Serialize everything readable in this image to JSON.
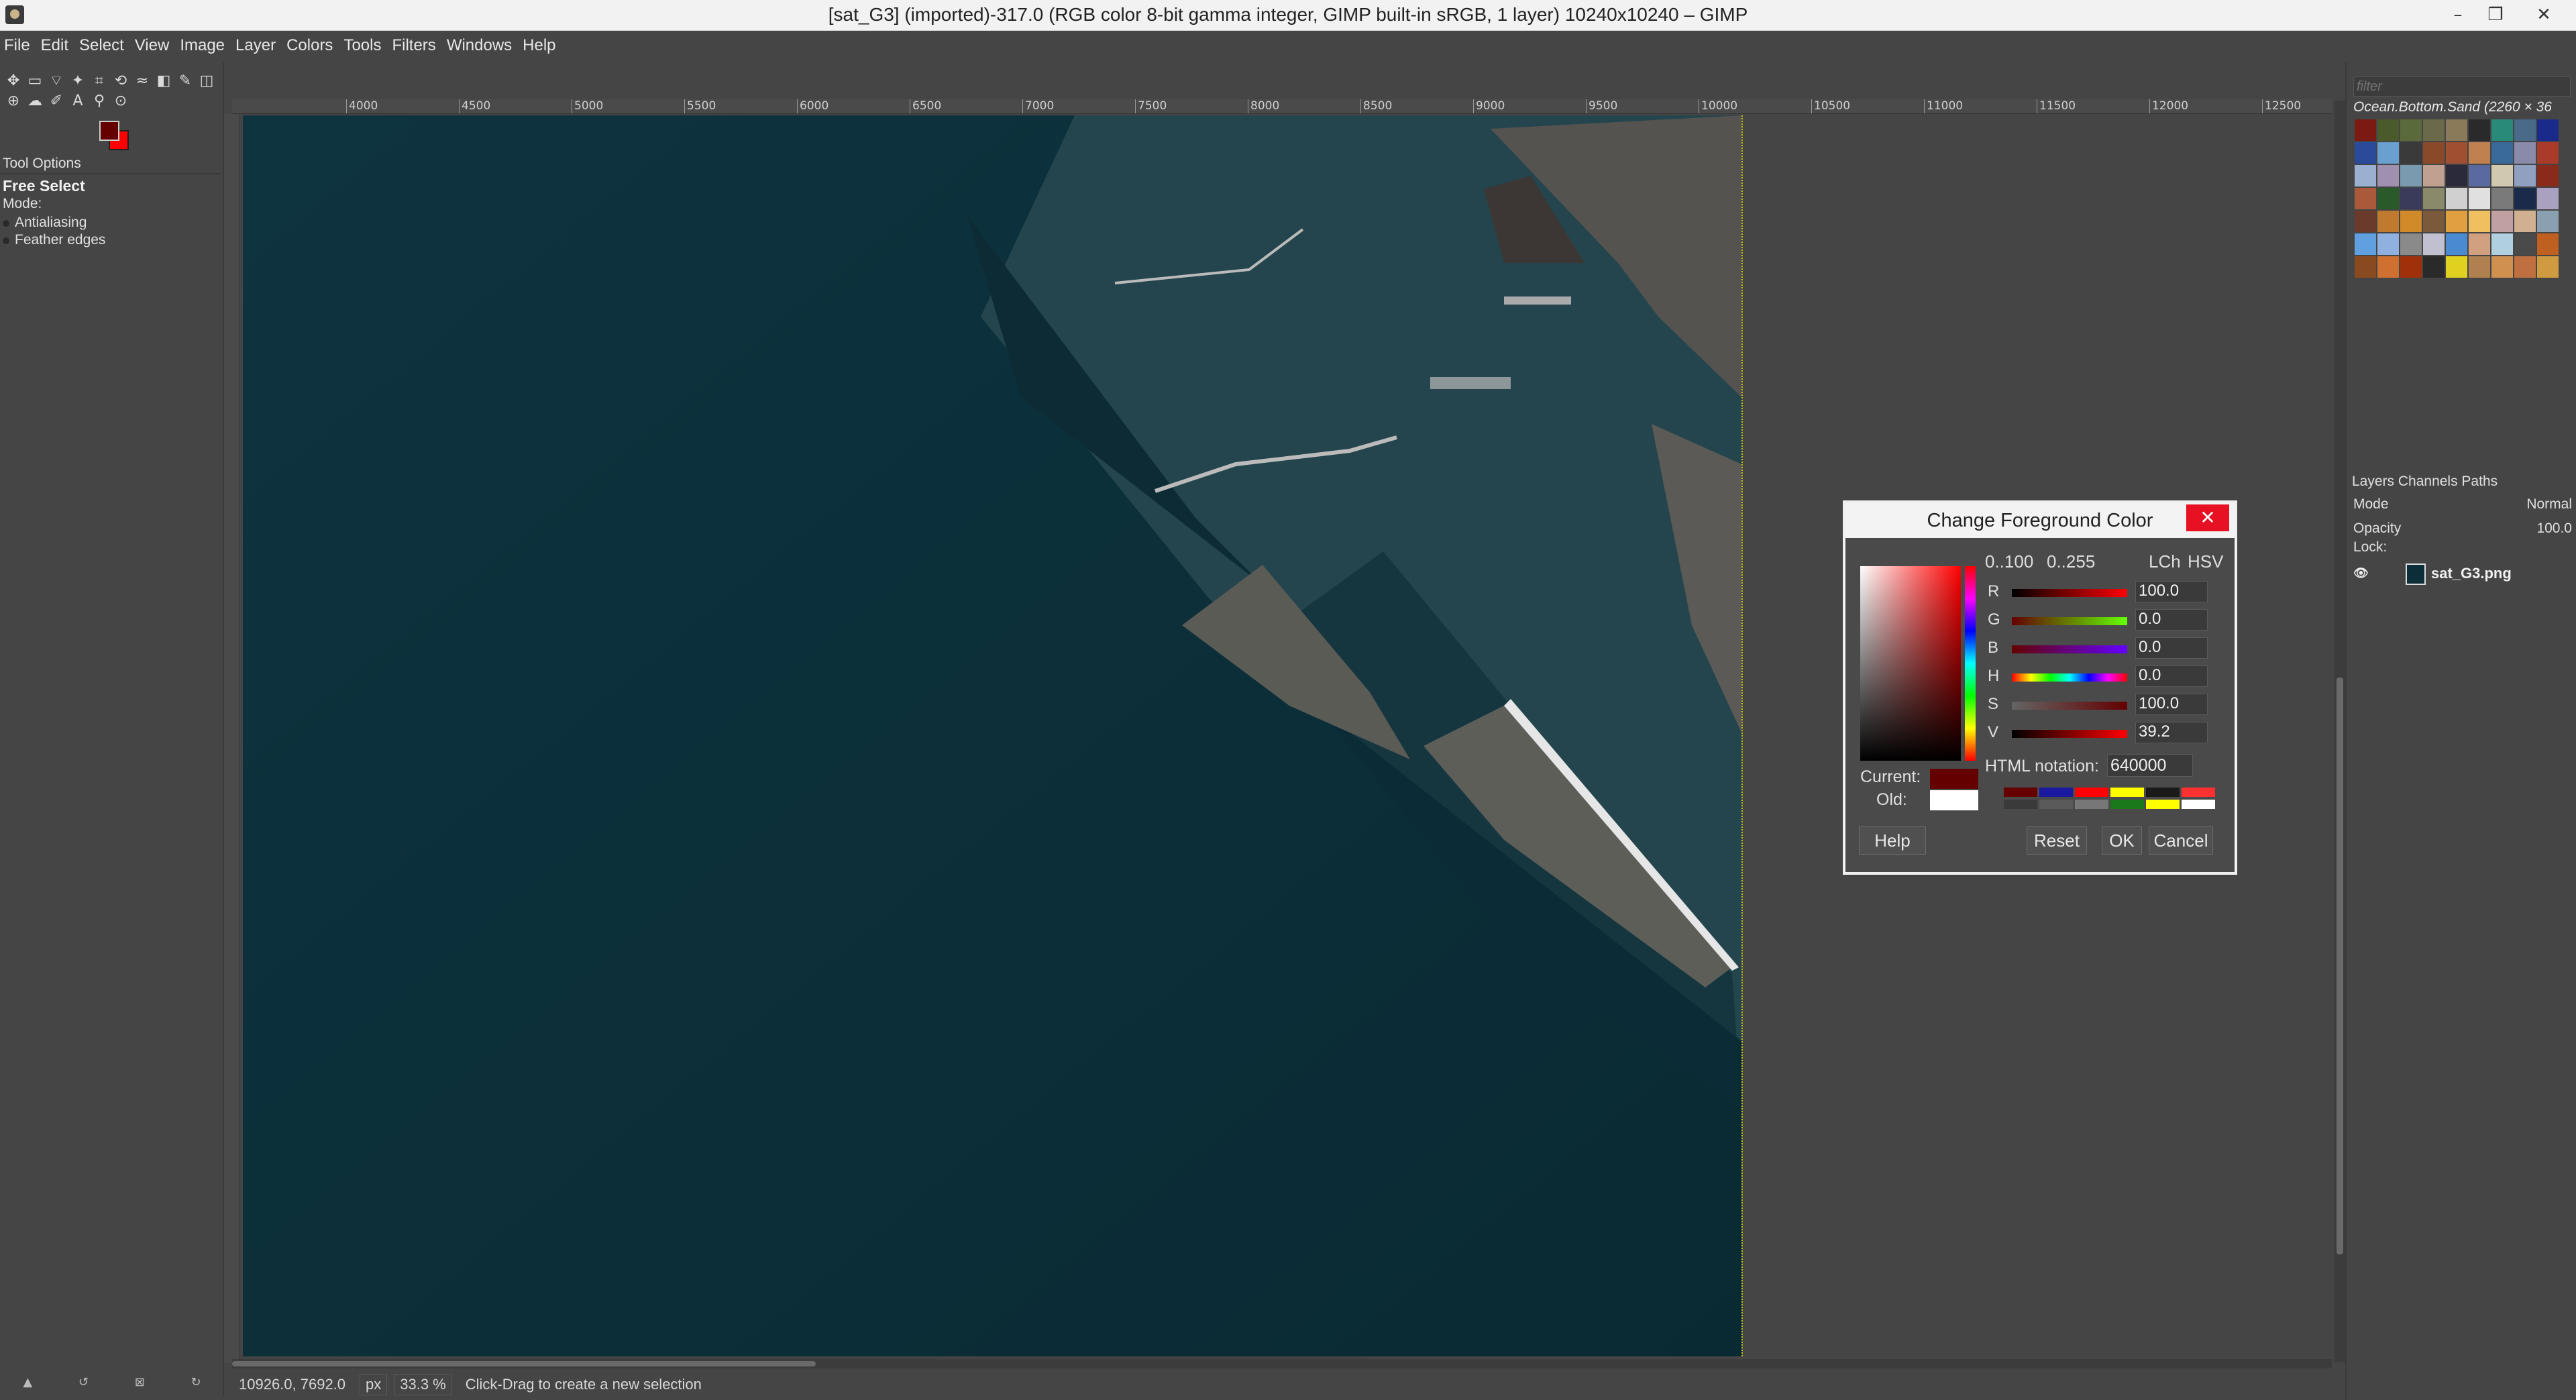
{
  "window": {
    "title": "[sat_G3] (imported)-317.0 (RGB color 8-bit gamma integer, GIMP built-in sRGB, 1 layer) 10240x10240 – GIMP",
    "minimize": "–",
    "maximize": "❐",
    "close": "✕"
  },
  "menu": [
    "File",
    "Edit",
    "Select",
    "View",
    "Image",
    "Layer",
    "Colors",
    "Tools",
    "Filters",
    "Windows",
    "Help"
  ],
  "toolbox": {
    "tool_icons": [
      "move-icon",
      "rect-select-icon",
      "free-select-icon",
      "fuzzy-select-icon",
      "crop-icon",
      "unified-transform-icon",
      "warp-icon",
      "bucket-fill-icon",
      "paintbrush-icon",
      "eraser-icon",
      "clone-icon",
      "smudge-icon",
      "path-icon",
      "text-icon",
      "color-picker-icon",
      "zoom-icon"
    ],
    "tool_glyphs": [
      "✥",
      "▭",
      "⌔",
      "✦",
      "⌗",
      "⟲",
      "≈",
      "◧",
      "✎",
      "◫",
      "⊕",
      "☁",
      "✐",
      "A",
      "⚲",
      "⊙"
    ],
    "fg_color": "#640000",
    "bg_color": "#ff0000"
  },
  "tool_options": {
    "tab_title": "Tool Options",
    "tool_name": "Free Select",
    "mode_label": "Mode:",
    "antialiasing": "Antialiasing",
    "feather": "Feather edges"
  },
  "ruler_ticks": [
    "4000",
    "4500",
    "5000",
    "5500",
    "6000",
    "6500",
    "7000",
    "7500",
    "8000",
    "8500",
    "9000",
    "9500",
    "10000",
    "10500",
    "11000",
    "11500",
    "12000",
    "12500"
  ],
  "status": {
    "coords": "10926.0, 7692.0",
    "unit": "px",
    "zoom": "33.3 %",
    "message": "Click-Drag to create a new selection"
  },
  "patterns": {
    "filter_placeholder": "filter",
    "selected_name": "Ocean.Bottom.Sand (2260 × 36",
    "colors": [
      "#7a1a12",
      "#4a5a2a",
      "#5a6a3a",
      "#6a6a4a",
      "#8a7a5a",
      "#2a2a2a",
      "#2a8a7a",
      "#4a6a8a",
      "#1a2a8a",
      "#2a4a9a",
      "#6aa0d0",
      "#3a3a3a",
      "#8a4a2a",
      "#a05030",
      "#c08050",
      "#3a6a9a",
      "#8a8aaa",
      "#aa3a2a",
      "#9ab0d0",
      "#a090b0",
      "#7a9ab0",
      "#c0a090",
      "#2a2a3a",
      "#5a6aa0",
      "#d0c8b0",
      "#90a0c0",
      "#8a2a1a",
      "#aa5a3a",
      "#2a5a2a",
      "#3a3a5a",
      "#8a8a6a",
      "#d0d0d0",
      "#e0e0e0",
      "#7a7a7a",
      "#1a2a4a",
      "#aaa0c0",
      "#6a3a2a",
      "#c07a30",
      "#d08a2a",
      "#7a5a3a",
      "#e0a040",
      "#f0c060",
      "#c0a0a0",
      "#d0b090",
      "#8aa0b0",
      "#60a0e0",
      "#90b0e0",
      "#8a8a8a",
      "#c0c0d0",
      "#4a8ad0",
      "#d0a080",
      "#b0d0e0",
      "#4a4a4a",
      "#c06020",
      "#8a4a20",
      "#d07030",
      "#a0300a",
      "#2a2a2a",
      "#e0d020",
      "#b08050",
      "#d09050",
      "#c07040",
      "#d09a40"
    ]
  },
  "layers": {
    "tabs": "Layers  Channels  Paths",
    "mode_label": "Mode",
    "mode_value": "Normal",
    "opacity_label": "Opacity",
    "opacity_value": "100.0",
    "lock_label": "Lock:",
    "layer_name": "sat_G3.png"
  },
  "dialog": {
    "title": "Change Foreground Color",
    "close": "✕",
    "range_100": "0..100",
    "range_255": "0..255",
    "lch": "LCh",
    "hsv": "HSV",
    "channels": [
      {
        "label": "R",
        "value": "100.0",
        "gradient": "linear-gradient(to right,#000,#f00)"
      },
      {
        "label": "G",
        "value": "0.0",
        "gradient": "linear-gradient(to right,#640000,#64ff00)"
      },
      {
        "label": "B",
        "value": "0.0",
        "gradient": "linear-gradient(to right,#640000,#6400ff)"
      },
      {
        "label": "H",
        "value": "0.0",
        "gradient": "linear-gradient(to right,#f00,#ff0,#0f0,#0ff,#00f,#f0f,#f00)"
      },
      {
        "label": "S",
        "value": "100.0",
        "gradient": "linear-gradient(to right,#646464,#640000)"
      },
      {
        "label": "V",
        "value": "39.2",
        "gradient": "linear-gradient(to right,#000,#f00)"
      }
    ],
    "current_label": "Current:",
    "old_label": "Old:",
    "current_color": "#640000",
    "old_color": "#ffffff",
    "html_label": "HTML notation:",
    "html_value": "640000",
    "history_colors": [
      "#640000",
      "#1a1aa0",
      "#ff0000",
      "#ffff00",
      "#1a1a1a",
      "#ff3030",
      "#3a3a3a",
      "#5a5a5a",
      "#777777",
      "#1a7a1a",
      "#ffff00",
      "#ffffff"
    ],
    "help": "Help",
    "reset": "Reset",
    "ok": "OK",
    "cancel": "Cancel"
  }
}
